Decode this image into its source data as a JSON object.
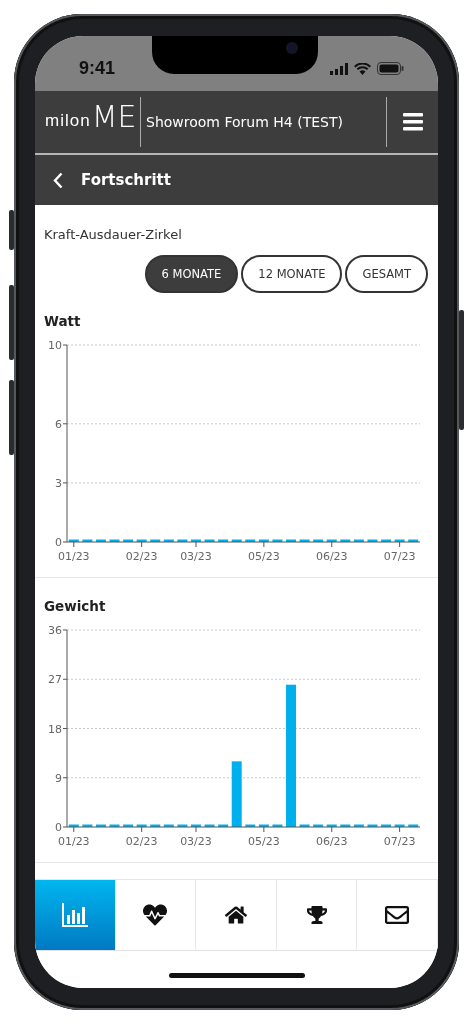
{
  "status_bar": {
    "time": "9:41"
  },
  "header": {
    "logo": {
      "text": "milon",
      "mark": "ME"
    },
    "title": "Showroom Forum H4 (TEST)"
  },
  "nav": {
    "title": "Fortschritt"
  },
  "program": "Kraft-Ausdauer-Zirkel",
  "ranges": [
    {
      "label": "6 MONATE",
      "selected": true
    },
    {
      "label": "12 MONATE",
      "selected": false
    },
    {
      "label": "GESAMT",
      "selected": false
    }
  ],
  "charts": [
    {
      "title": "Watt",
      "chart_data": {
        "type": "bar",
        "categories": [
          "01/23",
          null,
          null,
          null,
          null,
          "02/23",
          null,
          null,
          null,
          "03/23",
          null,
          null,
          null,
          null,
          "05/23",
          null,
          null,
          null,
          null,
          "06/23",
          null,
          null,
          null,
          null,
          "07/23",
          null
        ],
        "series": [
          {
            "color": "#00b0ec",
            "values": [
              0,
              0,
              0,
              0,
              0,
              0,
              0,
              0,
              0,
              0,
              0,
              0,
              0,
              0,
              0,
              0,
              0,
              0,
              0,
              0,
              0,
              0,
              0,
              0,
              0,
              0
            ]
          }
        ],
        "grid": true,
        "ylim": [
          0,
          10
        ],
        "yticks": [
          0,
          3,
          6,
          10
        ]
      }
    },
    {
      "title": "Gewicht",
      "chart_data": {
        "type": "bar",
        "categories": [
          "01/23",
          null,
          null,
          null,
          null,
          "02/23",
          null,
          null,
          null,
          "03/23",
          null,
          null,
          null,
          null,
          "05/23",
          null,
          null,
          null,
          null,
          "06/23",
          null,
          null,
          null,
          null,
          "07/23",
          null
        ],
        "series": [
          {
            "color": "#00b0ec",
            "values": [
              0,
              0,
              0,
              0,
              0,
              0,
              0,
              0,
              0,
              0,
              0,
              0,
              12,
              0,
              0,
              0,
              26,
              0,
              0,
              0,
              0,
              0,
              0,
              0,
              0,
              0
            ]
          }
        ],
        "grid": true,
        "ylim": [
          0,
          36
        ],
        "yticks": [
          0,
          9,
          18,
          27,
          36
        ]
      }
    }
  ],
  "tab_bar": [
    {
      "selected": true
    },
    {
      "selected": false
    },
    {
      "selected": false
    },
    {
      "selected": false
    },
    {
      "selected": false
    }
  ]
}
